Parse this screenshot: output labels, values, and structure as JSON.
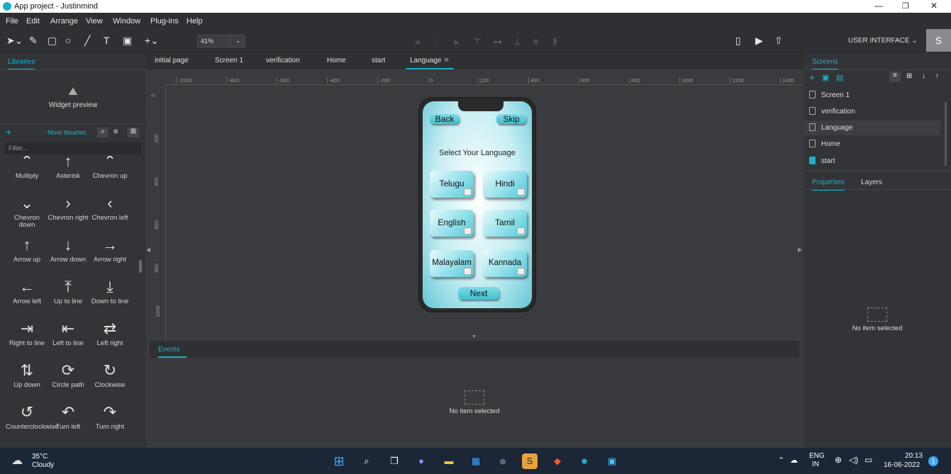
{
  "app": {
    "title": "App project - Justinmind"
  },
  "menu": [
    "File",
    "Edit",
    "Arrange",
    "View",
    "Window",
    "Plug-ins",
    "Help"
  ],
  "toolbar": {
    "zoom": "41%",
    "zoom_dropdown": "⌄",
    "ui_selector": "USER INTERFACE ⌄",
    "avatar": "S"
  },
  "left": {
    "tab": "Libraries",
    "widget_preview": "Widget preview",
    "more_libraries": "More libraries",
    "filter_placeholder": "Filter...",
    "icons": [
      {
        "label": "Multiply",
        "glyph": "⌃"
      },
      {
        "label": "Asterisk",
        "glyph": "↑"
      },
      {
        "label": "Chevron up",
        "glyph": "⌃"
      },
      {
        "label": "Chevron down",
        "glyph": "⌄"
      },
      {
        "label": "Chevron right",
        "glyph": "›"
      },
      {
        "label": "Chevron left",
        "glyph": "‹"
      },
      {
        "label": "Arrow up",
        "glyph": "↑"
      },
      {
        "label": "Arrow down",
        "glyph": "↓"
      },
      {
        "label": "Arrow right",
        "glyph": "→"
      },
      {
        "label": "Arrow left",
        "glyph": "←"
      },
      {
        "label": "Up to line",
        "glyph": "⤒"
      },
      {
        "label": "Down to line",
        "glyph": "⤓"
      },
      {
        "label": "Right to line",
        "glyph": "⇥"
      },
      {
        "label": "Left to line",
        "glyph": "⇤"
      },
      {
        "label": "Left right",
        "glyph": "⇄"
      },
      {
        "label": "Up down",
        "glyph": "⇅"
      },
      {
        "label": "Circle path",
        "glyph": "⟳"
      },
      {
        "label": "Clockwise",
        "glyph": "↻"
      },
      {
        "label": "Counterclockwise",
        "glyph": "↺"
      },
      {
        "label": "Turn left",
        "glyph": "↶"
      },
      {
        "label": "Turn right",
        "glyph": "↷"
      }
    ]
  },
  "tabs": [
    "initial page",
    "Screen 1",
    "verification",
    "Home",
    "start",
    "Language"
  ],
  "ruler": {
    "h": [
      "-1000",
      "-800",
      "-600",
      "-400",
      "-200",
      "0",
      "200",
      "400",
      "600",
      "800",
      "1000",
      "1200",
      "1400"
    ],
    "v": [
      "0",
      "200",
      "400",
      "600",
      "800",
      "1000"
    ]
  },
  "phone": {
    "back": "Back",
    "skip": "Skip",
    "heading": "Select Your Language",
    "languages": [
      "Telugu",
      "Hindi",
      "English",
      "Tamil",
      "Malayalam",
      "Kannada"
    ],
    "next": "Next"
  },
  "events": {
    "tab": "Events",
    "empty": "No item selected"
  },
  "right": {
    "screens_tab": "Screens",
    "screens": [
      "Screen 1",
      "verification",
      "Language",
      "Home",
      "start"
    ],
    "properties_tab": "Properties",
    "layers_tab": "Layers",
    "empty": "No item selected"
  },
  "taskbar": {
    "temp": "35°C",
    "weather": "Cloudy",
    "lang1": "ENG",
    "lang2": "IN",
    "time": "20:13",
    "date": "16-06-2022",
    "notif": "1"
  }
}
